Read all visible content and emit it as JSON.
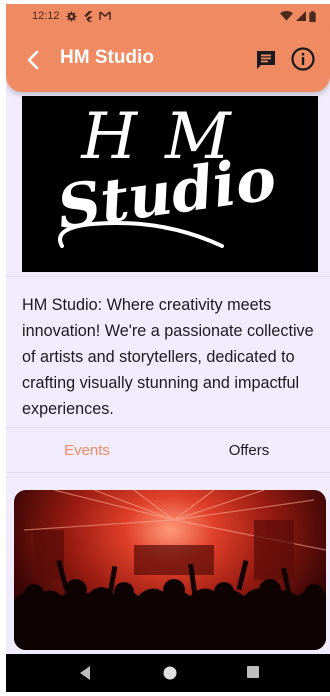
{
  "status_bar": {
    "time": "12:12",
    "left_icons": [
      "settings-icon",
      "flutter-icon",
      "gmail-icon"
    ],
    "right_icons": [
      "wifi-icon",
      "signal-icon",
      "battery-icon"
    ]
  },
  "app_bar": {
    "title": "HM Studio",
    "background_color": "#f08a63",
    "icons": [
      "back-arrow-icon",
      "chat-icon",
      "info-icon"
    ]
  },
  "logo": {
    "line1": "HM",
    "line2": "Studio"
  },
  "description": "HM Studio: Where creativity meets innovation! We're a passionate collective of artists and storytellers, dedicated to crafting visually stunning and impactful experiences.",
  "tabs": [
    {
      "label": "Events",
      "selected": true
    },
    {
      "label": "Offers",
      "selected": false
    }
  ],
  "accent_color": "#f08a63",
  "event_card": {
    "image": "concert-crowd-photo"
  },
  "nav_bar": {
    "icons": [
      "back-triangle-icon",
      "home-circle-icon",
      "recents-square-icon"
    ]
  }
}
